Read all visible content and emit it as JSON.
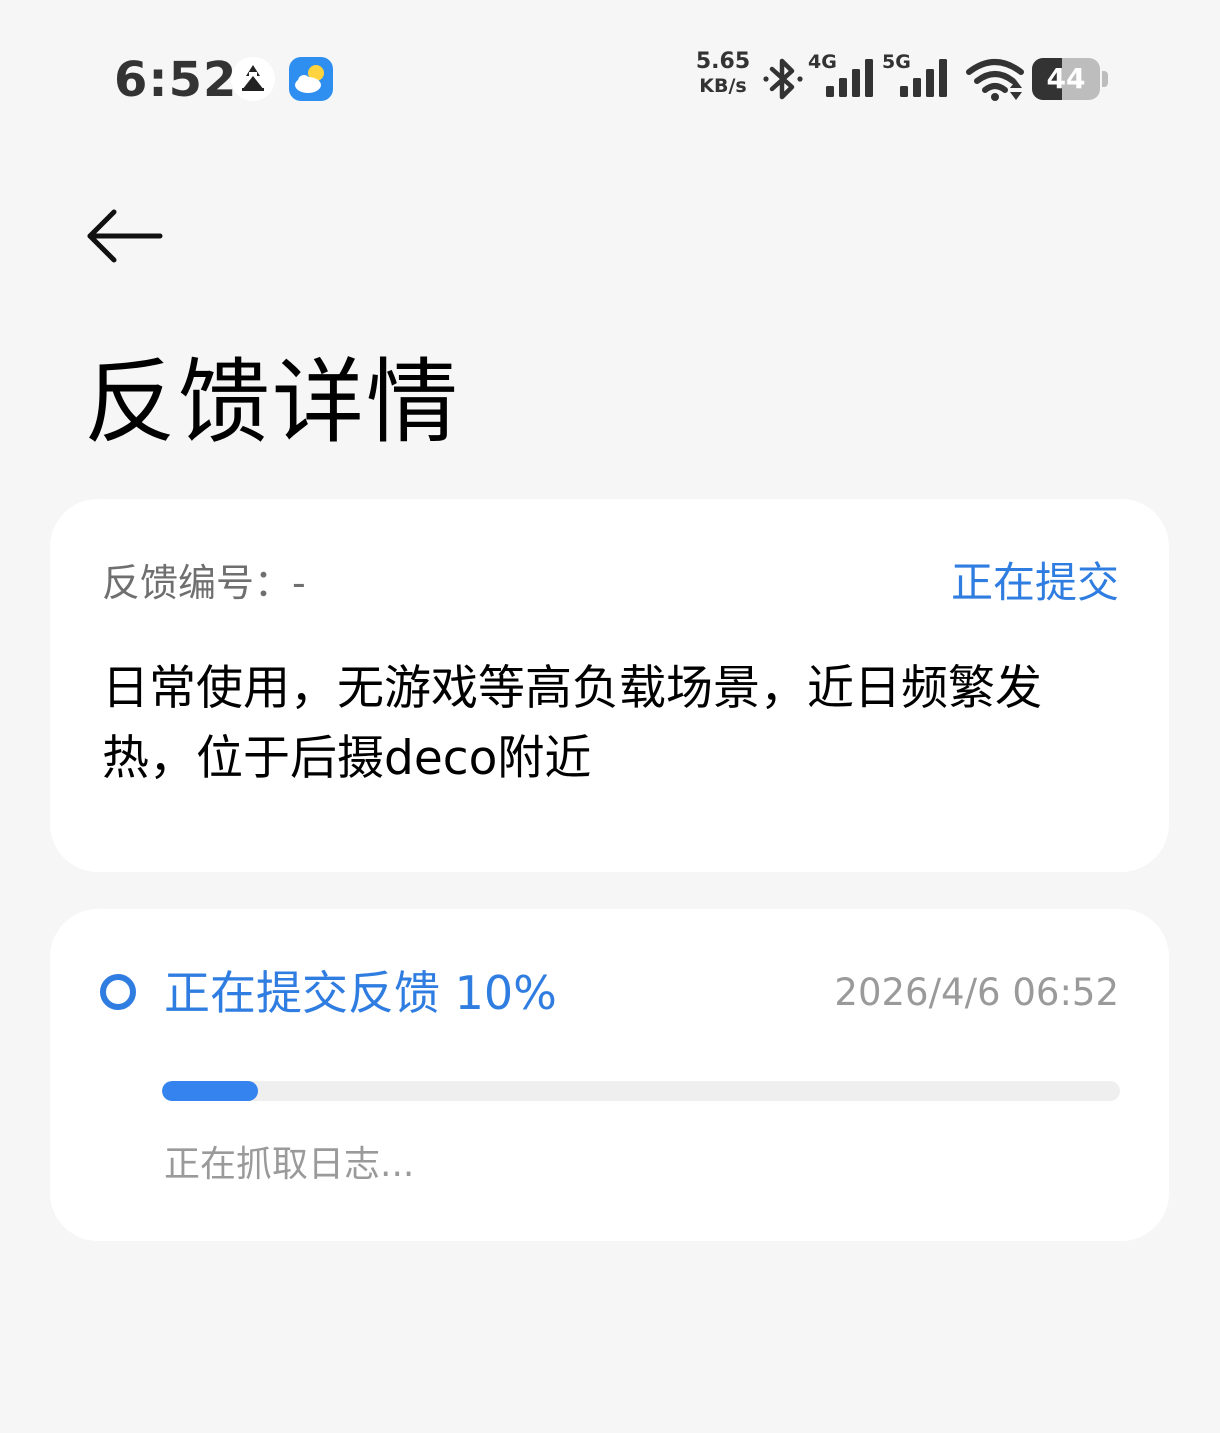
{
  "status_bar": {
    "time": "6:52",
    "net_speed_value": "5.65",
    "net_speed_unit": "KB/s",
    "signal_1_label": "4G",
    "signal_2_label": "5G",
    "battery_level": "44",
    "battery_fraction": 0.44,
    "icons": [
      "app-notification-icon",
      "weather-icon",
      "bluetooth-icon",
      "cell-signal-icon",
      "wifi-icon",
      "battery-icon"
    ]
  },
  "header": {
    "back_icon": "back-arrow-icon",
    "title": "反馈详情"
  },
  "detail_card": {
    "feedback_id_label": "反馈编号：-",
    "status": "正在提交",
    "description": "日常使用，无游戏等高负载场景，近日频繁发热，位于后摄deco附近"
  },
  "progress_card": {
    "title": "正在提交反馈 10%",
    "timestamp": "2026/4/6 06:52",
    "progress": 0.1,
    "subtitle": "正在抓取日志..."
  },
  "colors": {
    "background": "#f6f6f6",
    "card": "#ffffff",
    "accent": "#2f7de1",
    "secondary_text": "#9a9a9a"
  }
}
